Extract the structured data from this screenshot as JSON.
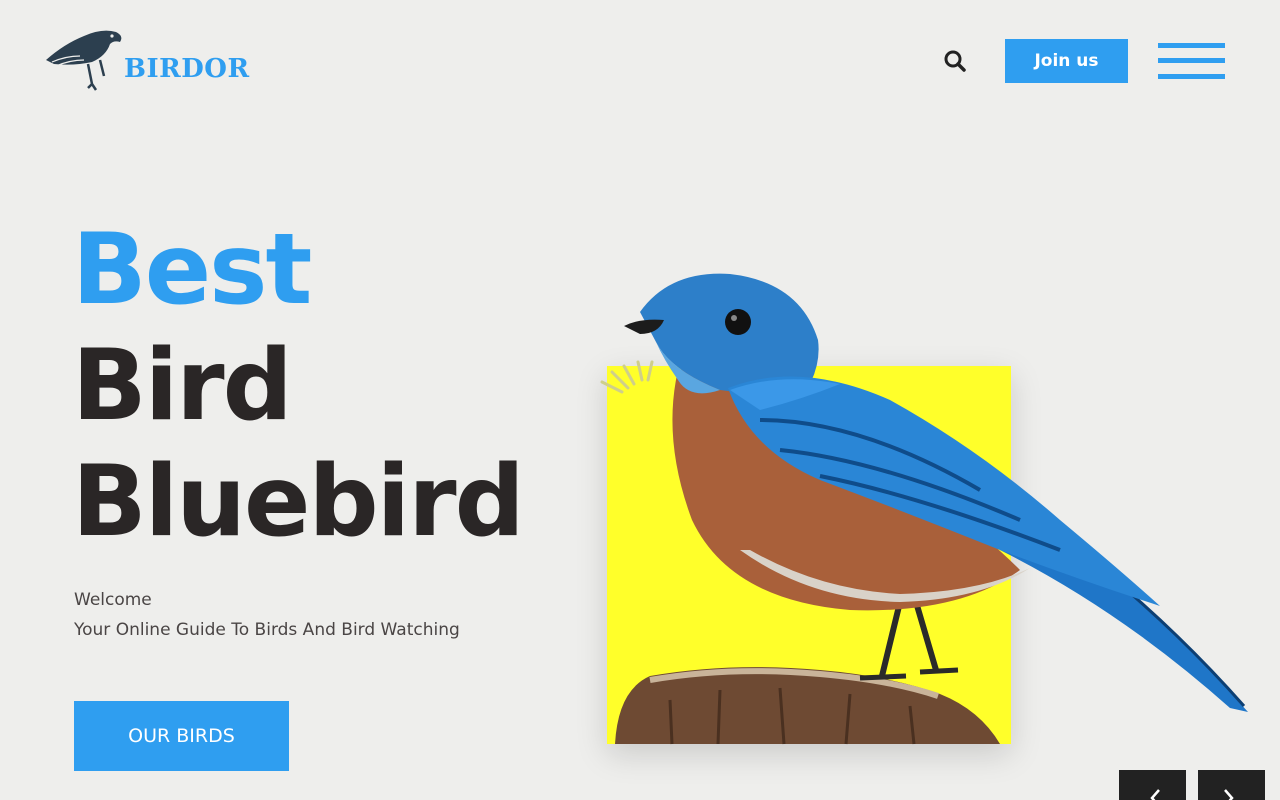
{
  "brand": {
    "name": "BIRDOR"
  },
  "header": {
    "join_label": "Join us",
    "search_icon": "search-icon",
    "menu_icon": "hamburger-menu-icon"
  },
  "hero": {
    "line1": "Best",
    "line2": "Bird",
    "line3": "Bluebird",
    "welcome": "Welcome",
    "tagline": "Your Online Guide To Birds And Bird Watching",
    "cta_label": "OUR BIRDS"
  },
  "slider": {
    "prev_icon": "chevron-left-icon",
    "next_icon": "chevron-right-icon"
  },
  "colors": {
    "accent": "#2f9ef0",
    "dark": "#2a2626",
    "background": "#eeeeec",
    "highlight": "#ffff2a"
  }
}
